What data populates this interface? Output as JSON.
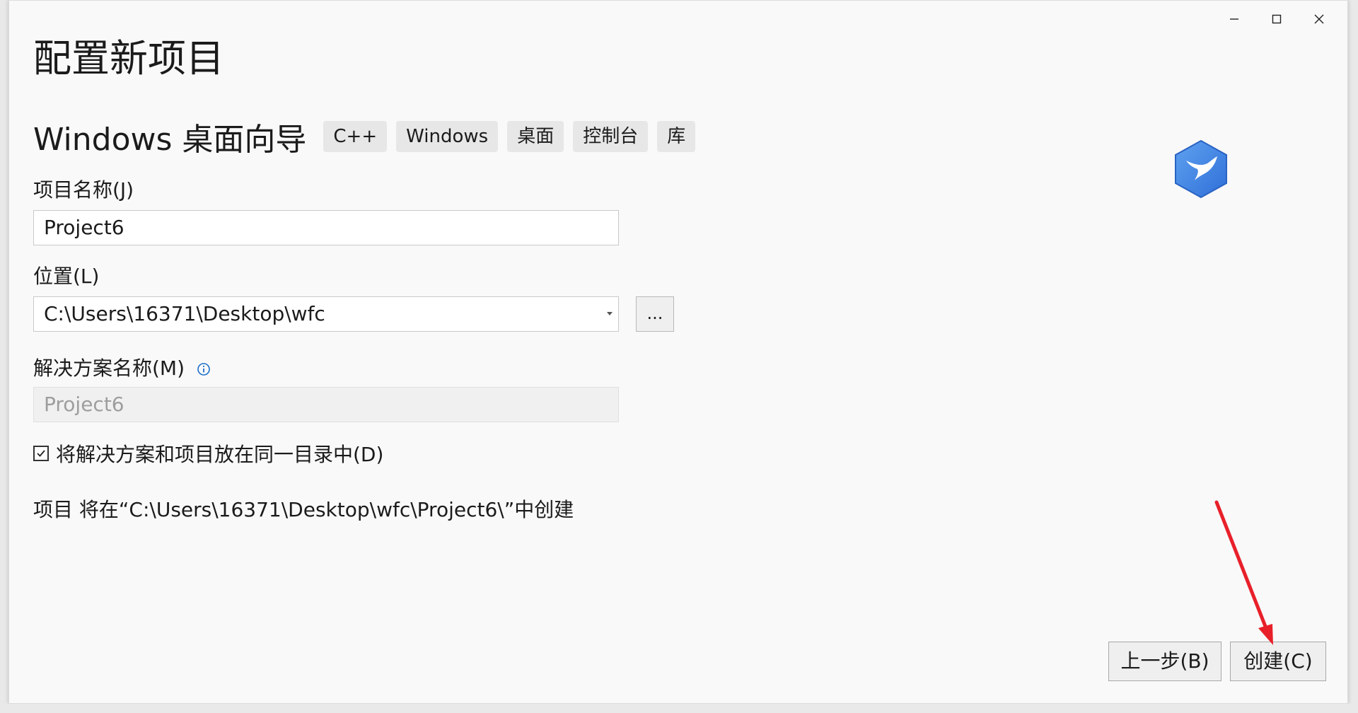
{
  "window": {
    "controls": {
      "minimize_icon": "minimize-icon",
      "maximize_icon": "maximize-icon",
      "close_icon": "close-icon"
    }
  },
  "page_title": "配置新项目",
  "template": {
    "name": "Windows 桌面向导",
    "tags": [
      "C++",
      "Windows",
      "桌面",
      "控制台",
      "库"
    ],
    "logo_icon": "visual-studio-bird-icon",
    "logo_color": "#3c7fe0"
  },
  "project_name": {
    "label": "项目名称(J)",
    "value": "Project6"
  },
  "location": {
    "label": "位置(L)",
    "value": "C:\\Users\\16371\\Desktop\\wfc",
    "browse_label": "..."
  },
  "solution_name": {
    "label": "解决方案名称(M)",
    "info_icon": "info-icon",
    "value": "Project6"
  },
  "same_directory": {
    "label": "将解决方案和项目放在同一目录中(D)",
    "checked": true
  },
  "path_note": "项目 将在“C:\\Users\\16371\\Desktop\\wfc\\Project6\\”中创建",
  "buttons": {
    "back": "上一步(B)",
    "create": "创建(C)"
  },
  "annotation": {
    "color": "#e8202a"
  }
}
